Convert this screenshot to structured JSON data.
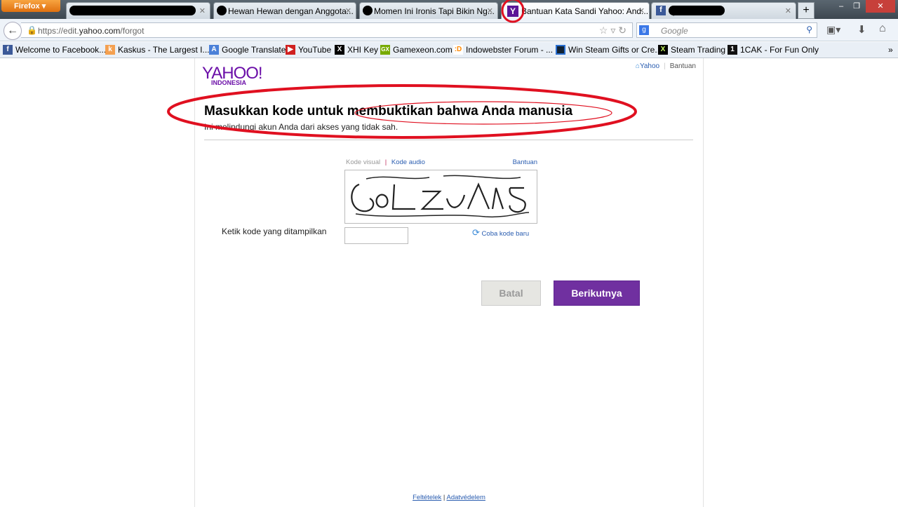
{
  "browser": {
    "menu_button": "Firefox",
    "tabs": [
      {
        "title": ""
      },
      {
        "title": "Hewan Hewan dengan Anggota..."
      },
      {
        "title": "Momen Ini Ironis Tapi Bikin Ng..."
      },
      {
        "title": "Bantuan Kata Sandi Yahoo: And...",
        "active": true
      },
      {
        "title": "(..."
      }
    ],
    "url_prefix": "https://edit.",
    "url_domain": "yahoo.com",
    "url_path": "/forgot",
    "search_placeholder": "Google",
    "bookmarks": [
      "Welcome to Facebook...",
      "Kaskus - The Largest I...",
      "Google Translate",
      "YouTube",
      "XHI Key",
      "Gamexeon.com",
      "Indowebster Forum - ...",
      "Win Steam Gifts or Cre...",
      "Steam Trading",
      "1CAK - For Fun Only"
    ],
    "overflow": "»"
  },
  "page": {
    "logo": "YAHOO!",
    "logo_sub": "INDONESIA",
    "top_links": [
      "Yahoo",
      "Bantuan"
    ],
    "title": "Masukkan kode untuk membuktikan bahwa Anda manusia",
    "subtitle": "Ini melindungi akun Anda dari akses yang tidak sah.",
    "captcha_tabs": {
      "visual": "Kode visual",
      "audio": "Kode audio",
      "help": "Bantuan"
    },
    "input_label": "Ketik kode yang ditampilkan",
    "input_value": "",
    "refresh": "Coba kode baru",
    "cancel": "Batal",
    "next": "Berikutnya",
    "footer": {
      "terms": "Feltételek",
      "sep": "|",
      "privacy": "Adatvédelem"
    }
  },
  "colors": {
    "brand": "#7030a0",
    "link": "#2a5db0",
    "annotation": "#e01020"
  }
}
